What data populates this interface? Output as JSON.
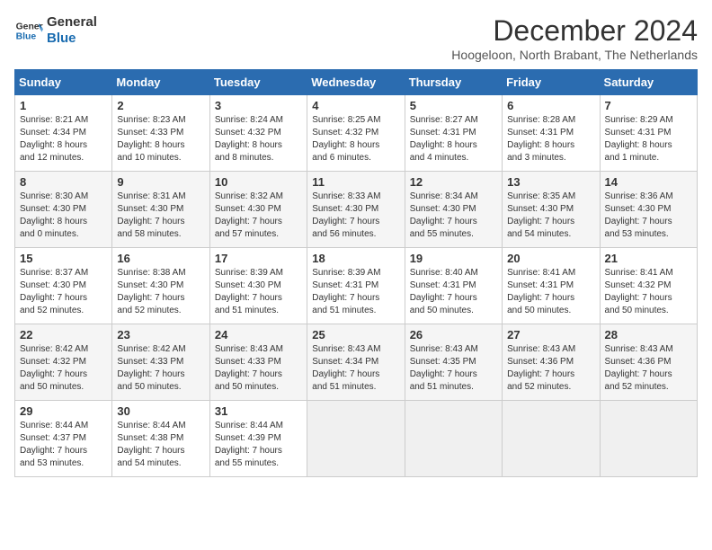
{
  "header": {
    "logo_line1": "General",
    "logo_line2": "Blue",
    "month_title": "December 2024",
    "location": "Hoogeloon, North Brabant, The Netherlands"
  },
  "days_of_week": [
    "Sunday",
    "Monday",
    "Tuesday",
    "Wednesday",
    "Thursday",
    "Friday",
    "Saturday"
  ],
  "weeks": [
    [
      {
        "day": "1",
        "lines": [
          "Sunrise: 8:21 AM",
          "Sunset: 4:34 PM",
          "Daylight: 8 hours",
          "and 12 minutes."
        ]
      },
      {
        "day": "2",
        "lines": [
          "Sunrise: 8:23 AM",
          "Sunset: 4:33 PM",
          "Daylight: 8 hours",
          "and 10 minutes."
        ]
      },
      {
        "day": "3",
        "lines": [
          "Sunrise: 8:24 AM",
          "Sunset: 4:32 PM",
          "Daylight: 8 hours",
          "and 8 minutes."
        ]
      },
      {
        "day": "4",
        "lines": [
          "Sunrise: 8:25 AM",
          "Sunset: 4:32 PM",
          "Daylight: 8 hours",
          "and 6 minutes."
        ]
      },
      {
        "day": "5",
        "lines": [
          "Sunrise: 8:27 AM",
          "Sunset: 4:31 PM",
          "Daylight: 8 hours",
          "and 4 minutes."
        ]
      },
      {
        "day": "6",
        "lines": [
          "Sunrise: 8:28 AM",
          "Sunset: 4:31 PM",
          "Daylight: 8 hours",
          "and 3 minutes."
        ]
      },
      {
        "day": "7",
        "lines": [
          "Sunrise: 8:29 AM",
          "Sunset: 4:31 PM",
          "Daylight: 8 hours",
          "and 1 minute."
        ]
      }
    ],
    [
      {
        "day": "8",
        "lines": [
          "Sunrise: 8:30 AM",
          "Sunset: 4:30 PM",
          "Daylight: 8 hours",
          "and 0 minutes."
        ]
      },
      {
        "day": "9",
        "lines": [
          "Sunrise: 8:31 AM",
          "Sunset: 4:30 PM",
          "Daylight: 7 hours",
          "and 58 minutes."
        ]
      },
      {
        "day": "10",
        "lines": [
          "Sunrise: 8:32 AM",
          "Sunset: 4:30 PM",
          "Daylight: 7 hours",
          "and 57 minutes."
        ]
      },
      {
        "day": "11",
        "lines": [
          "Sunrise: 8:33 AM",
          "Sunset: 4:30 PM",
          "Daylight: 7 hours",
          "and 56 minutes."
        ]
      },
      {
        "day": "12",
        "lines": [
          "Sunrise: 8:34 AM",
          "Sunset: 4:30 PM",
          "Daylight: 7 hours",
          "and 55 minutes."
        ]
      },
      {
        "day": "13",
        "lines": [
          "Sunrise: 8:35 AM",
          "Sunset: 4:30 PM",
          "Daylight: 7 hours",
          "and 54 minutes."
        ]
      },
      {
        "day": "14",
        "lines": [
          "Sunrise: 8:36 AM",
          "Sunset: 4:30 PM",
          "Daylight: 7 hours",
          "and 53 minutes."
        ]
      }
    ],
    [
      {
        "day": "15",
        "lines": [
          "Sunrise: 8:37 AM",
          "Sunset: 4:30 PM",
          "Daylight: 7 hours",
          "and 52 minutes."
        ]
      },
      {
        "day": "16",
        "lines": [
          "Sunrise: 8:38 AM",
          "Sunset: 4:30 PM",
          "Daylight: 7 hours",
          "and 52 minutes."
        ]
      },
      {
        "day": "17",
        "lines": [
          "Sunrise: 8:39 AM",
          "Sunset: 4:30 PM",
          "Daylight: 7 hours",
          "and 51 minutes."
        ]
      },
      {
        "day": "18",
        "lines": [
          "Sunrise: 8:39 AM",
          "Sunset: 4:31 PM",
          "Daylight: 7 hours",
          "and 51 minutes."
        ]
      },
      {
        "day": "19",
        "lines": [
          "Sunrise: 8:40 AM",
          "Sunset: 4:31 PM",
          "Daylight: 7 hours",
          "and 50 minutes."
        ]
      },
      {
        "day": "20",
        "lines": [
          "Sunrise: 8:41 AM",
          "Sunset: 4:31 PM",
          "Daylight: 7 hours",
          "and 50 minutes."
        ]
      },
      {
        "day": "21",
        "lines": [
          "Sunrise: 8:41 AM",
          "Sunset: 4:32 PM",
          "Daylight: 7 hours",
          "and 50 minutes."
        ]
      }
    ],
    [
      {
        "day": "22",
        "lines": [
          "Sunrise: 8:42 AM",
          "Sunset: 4:32 PM",
          "Daylight: 7 hours",
          "and 50 minutes."
        ]
      },
      {
        "day": "23",
        "lines": [
          "Sunrise: 8:42 AM",
          "Sunset: 4:33 PM",
          "Daylight: 7 hours",
          "and 50 minutes."
        ]
      },
      {
        "day": "24",
        "lines": [
          "Sunrise: 8:43 AM",
          "Sunset: 4:33 PM",
          "Daylight: 7 hours",
          "and 50 minutes."
        ]
      },
      {
        "day": "25",
        "lines": [
          "Sunrise: 8:43 AM",
          "Sunset: 4:34 PM",
          "Daylight: 7 hours",
          "and 51 minutes."
        ]
      },
      {
        "day": "26",
        "lines": [
          "Sunrise: 8:43 AM",
          "Sunset: 4:35 PM",
          "Daylight: 7 hours",
          "and 51 minutes."
        ]
      },
      {
        "day": "27",
        "lines": [
          "Sunrise: 8:43 AM",
          "Sunset: 4:36 PM",
          "Daylight: 7 hours",
          "and 52 minutes."
        ]
      },
      {
        "day": "28",
        "lines": [
          "Sunrise: 8:43 AM",
          "Sunset: 4:36 PM",
          "Daylight: 7 hours",
          "and 52 minutes."
        ]
      }
    ],
    [
      {
        "day": "29",
        "lines": [
          "Sunrise: 8:44 AM",
          "Sunset: 4:37 PM",
          "Daylight: 7 hours",
          "and 53 minutes."
        ]
      },
      {
        "day": "30",
        "lines": [
          "Sunrise: 8:44 AM",
          "Sunset: 4:38 PM",
          "Daylight: 7 hours",
          "and 54 minutes."
        ]
      },
      {
        "day": "31",
        "lines": [
          "Sunrise: 8:44 AM",
          "Sunset: 4:39 PM",
          "Daylight: 7 hours",
          "and 55 minutes."
        ]
      },
      null,
      null,
      null,
      null
    ]
  ]
}
